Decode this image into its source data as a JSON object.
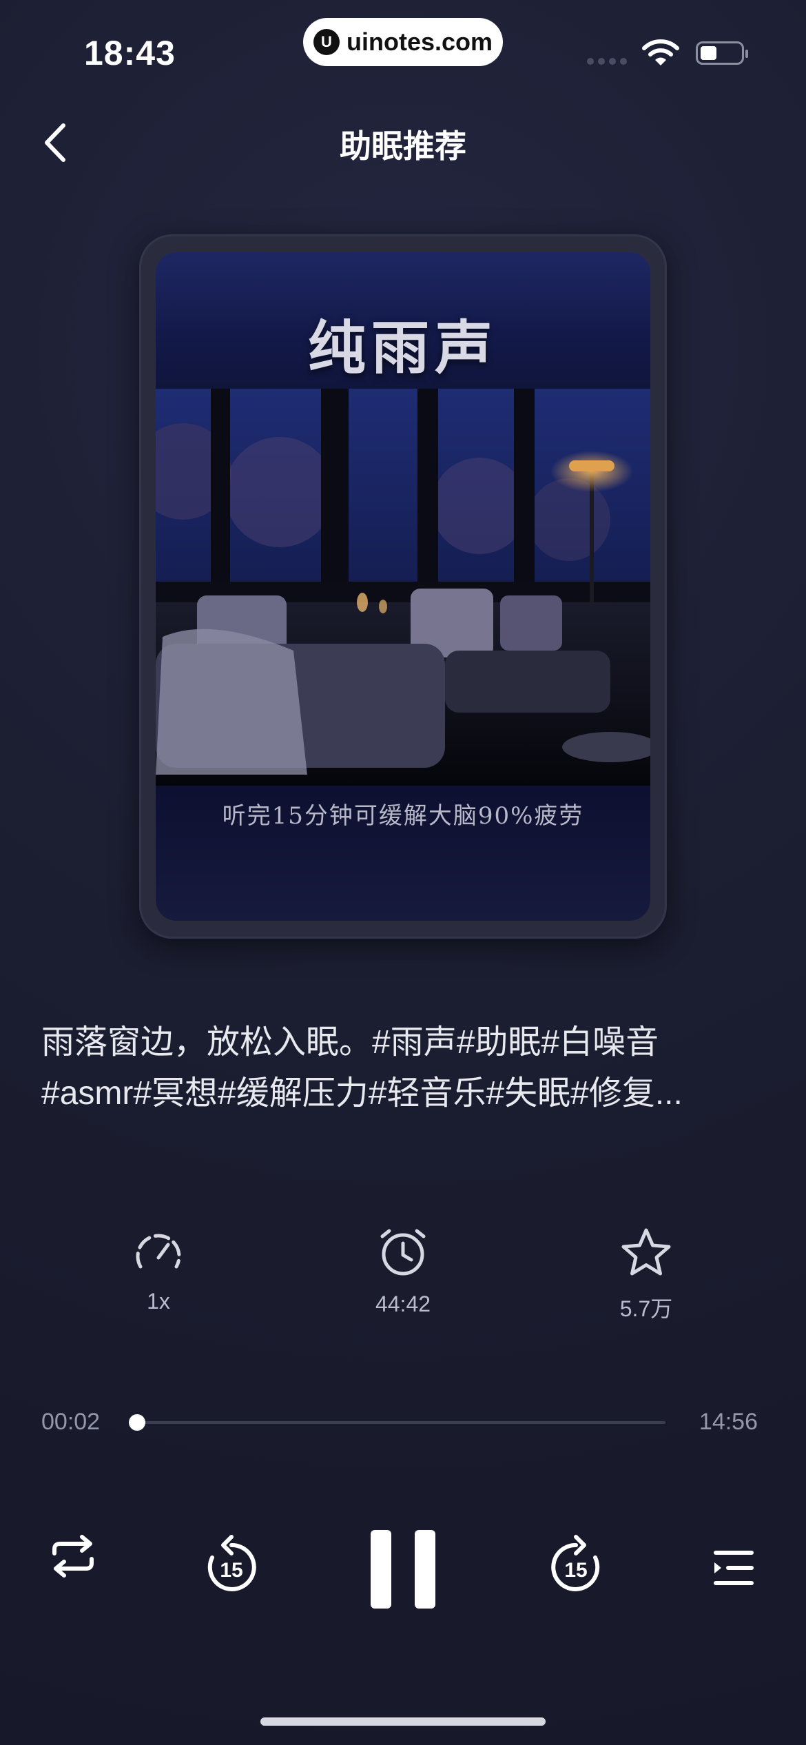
{
  "status_bar": {
    "time": "18:43",
    "watermark": "uinotes.com",
    "battery_level": 0.4,
    "icons": [
      "cellular-icon",
      "wifi-icon",
      "battery-icon"
    ]
  },
  "nav": {
    "back_icon": "chevron-left-icon",
    "title": "助眠推荐"
  },
  "cover": {
    "title": "纯雨声",
    "caption": "听完15分钟可缓解大脑90%疲劳"
  },
  "description": "雨落窗边，放松入眠。#雨声#助眠#白噪音#asmr#冥想#缓解压力#轻音乐#失眠#修复...",
  "controls": {
    "speed": {
      "icon": "speedometer-icon",
      "label": "1x"
    },
    "timer": {
      "icon": "alarm-clock-icon",
      "label": "44:42"
    },
    "favorite": {
      "icon": "star-icon",
      "label": "5.7万"
    }
  },
  "progress": {
    "current": "00:02",
    "total": "14:56",
    "fraction": 0.002
  },
  "player": {
    "repeat_icon": "repeat-icon",
    "rewind_icon": "rewind-15-icon",
    "rewind_label": "15",
    "pause_icon": "pause-icon",
    "forward_icon": "forward-15-icon",
    "forward_label": "15",
    "playlist_icon": "playlist-icon"
  },
  "colors": {
    "background": "#1b1d30",
    "accent": "#ffffff",
    "muted": "#9598ab"
  }
}
